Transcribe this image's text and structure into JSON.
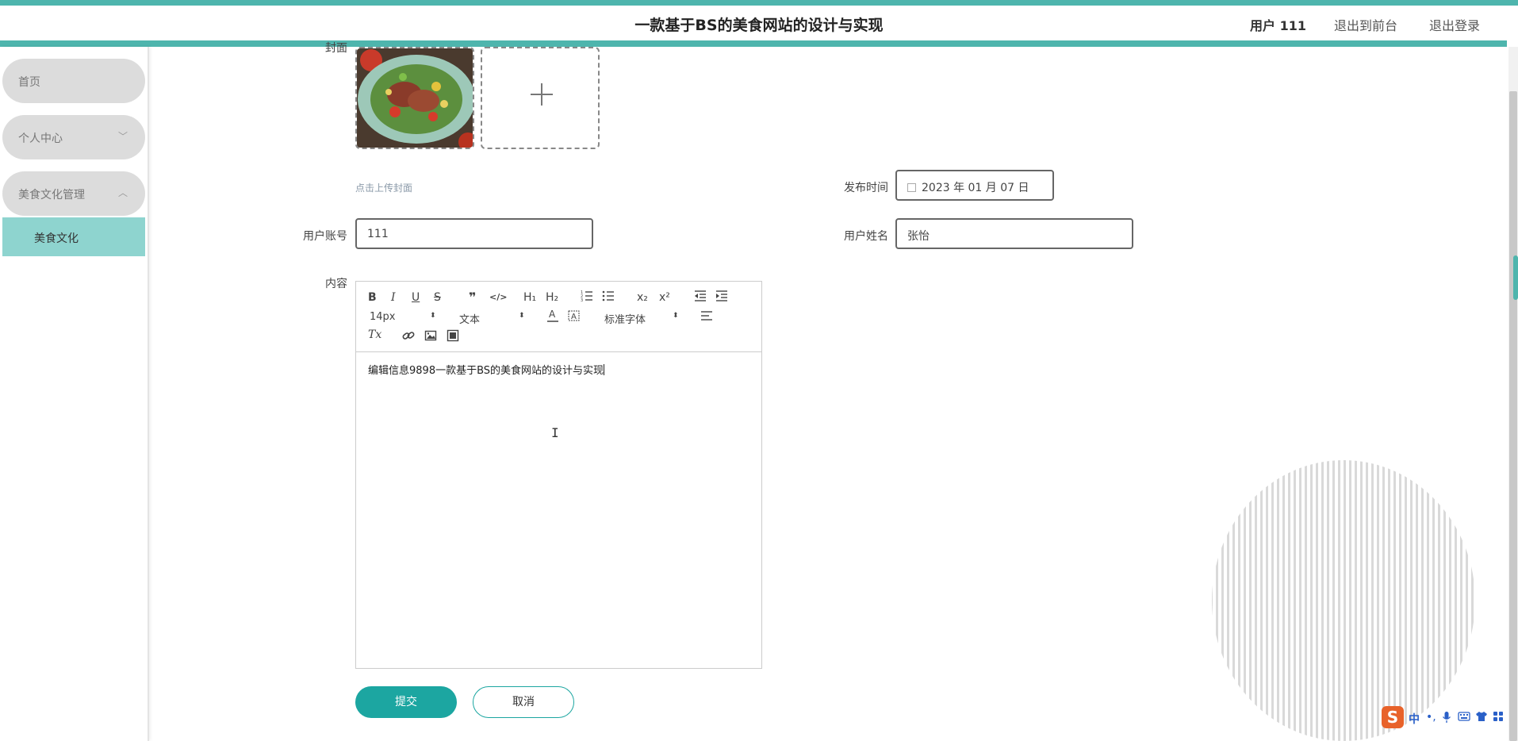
{
  "header": {
    "title": "一款基于BS的美食网站的设计与实现",
    "user_label": "用户 111",
    "to_front_label": "退出到前台",
    "logout_label": "退出登录"
  },
  "sidebar": {
    "items": [
      {
        "label": "首页"
      },
      {
        "label": "个人中心"
      },
      {
        "label": "美食文化管理"
      }
    ],
    "subitems": [
      {
        "label": "美食文化"
      }
    ]
  },
  "form": {
    "cover_label": "封面",
    "cover_hint": "点击上传封面",
    "publish_time_label": "发布时间",
    "publish_time_value": "2023 年 01 月 07 日",
    "account_label": "用户账号",
    "account_value": "111",
    "name_label": "用户姓名",
    "name_value": "张怡",
    "content_label": "内容",
    "content_value": "编辑信息9898一款基于BS的美食网站的设计与实现",
    "submit_label": "提交",
    "cancel_label": "取消"
  },
  "editor_toolbar": {
    "bold": "B",
    "italic": "I",
    "underline": "U",
    "strike": "S",
    "blockquote": "❞",
    "code": "</>",
    "h1": "H₁",
    "h2": "H₂",
    "subscript": "x₂",
    "superscript": "x²",
    "size_value": "14px",
    "header_value": "文本",
    "font_value": "标准字体",
    "clean": "Tx"
  },
  "ime": {
    "logo": "S",
    "lang": "中"
  },
  "colors": {
    "accent": "#4eb5ad",
    "button": "#1ca6a1",
    "submenu_active": "#8ed4cf"
  },
  "icons": [
    "bold-icon",
    "italic-icon",
    "underline-icon",
    "strike-icon",
    "blockquote-icon",
    "code-icon",
    "ordered-list-icon",
    "bullet-list-icon",
    "outdent-icon",
    "indent-icon",
    "text-color-icon",
    "background-color-icon",
    "align-icon",
    "clear-format-icon",
    "link-icon",
    "image-icon",
    "video-icon",
    "plus-icon",
    "calendar-icon"
  ]
}
